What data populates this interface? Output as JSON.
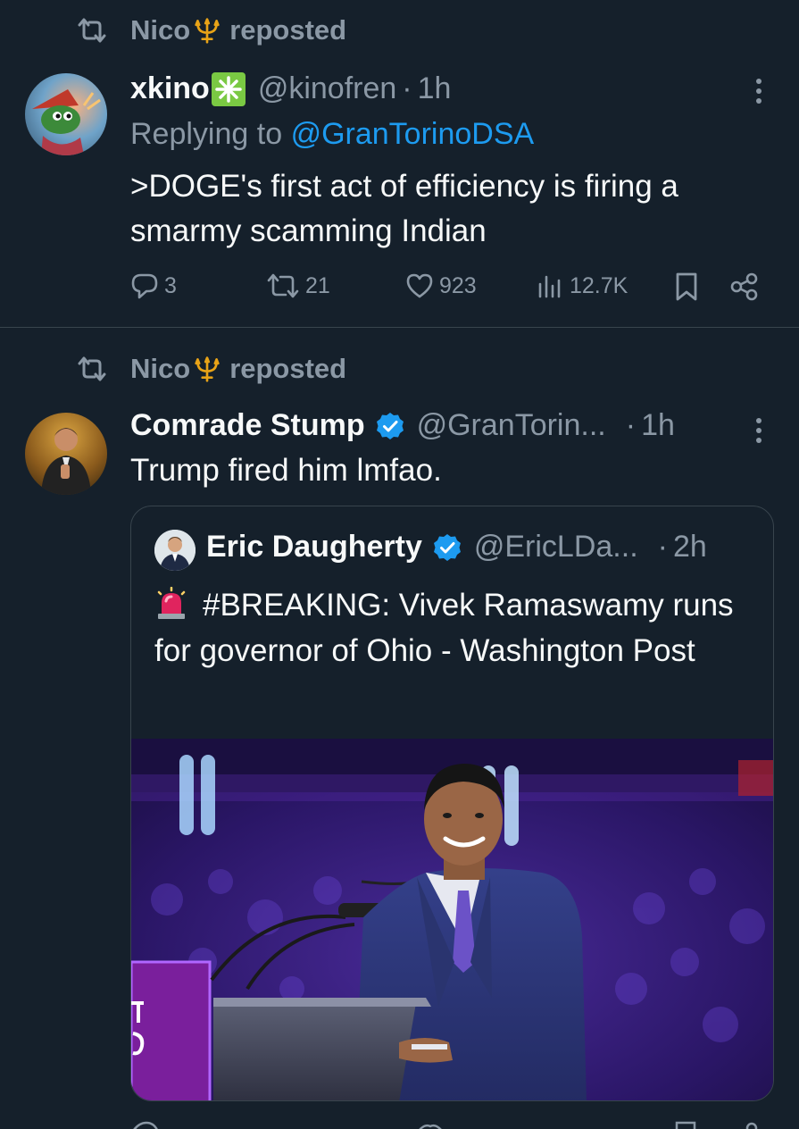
{
  "tweets": [
    {
      "reposter": "Nico",
      "reposted_label": "reposted",
      "author_name": "xkino",
      "author_handle": "@kinofren",
      "dot": "·",
      "time": "1h",
      "replying_to_prefix": "Replying to",
      "replying_to_handle": "@GranTorinoDSA",
      "text": ">DOGE's first act of efficiency is firing a smarmy scamming Indian",
      "stats": {
        "replies": "3",
        "reposts": "21",
        "likes": "923",
        "views": "12.7K"
      }
    },
    {
      "reposter": "Nico",
      "reposted_label": "reposted",
      "author_name": "Comrade Stump",
      "author_handle": "@GranTorin...",
      "dot": "·",
      "time": "1h",
      "text": "Trump fired him lmfao.",
      "quote": {
        "author_name": "Eric Daugherty",
        "author_handle": "@EricLDa...",
        "dot": "·",
        "time": "2h",
        "text": "#BREAKING: Vivek Ramaswamy runs for governor of Ohio - Washington Post",
        "image_alt": "Man in a blue suit smiling at a podium with microphones in front of a purple-lit crowd"
      }
    }
  ],
  "colors": {
    "background": "#15202b",
    "text_primary": "#f7f9f9",
    "text_secondary": "#8b98a5",
    "accent": "#1d9bf0",
    "divider": "#38444d"
  },
  "icons": [
    "repost-icon",
    "trident-icon",
    "sparkle-icon",
    "more-icon",
    "reply-icon",
    "like-icon",
    "views-icon",
    "bookmark-icon",
    "share-icon",
    "verified-icon",
    "siren-icon"
  ]
}
